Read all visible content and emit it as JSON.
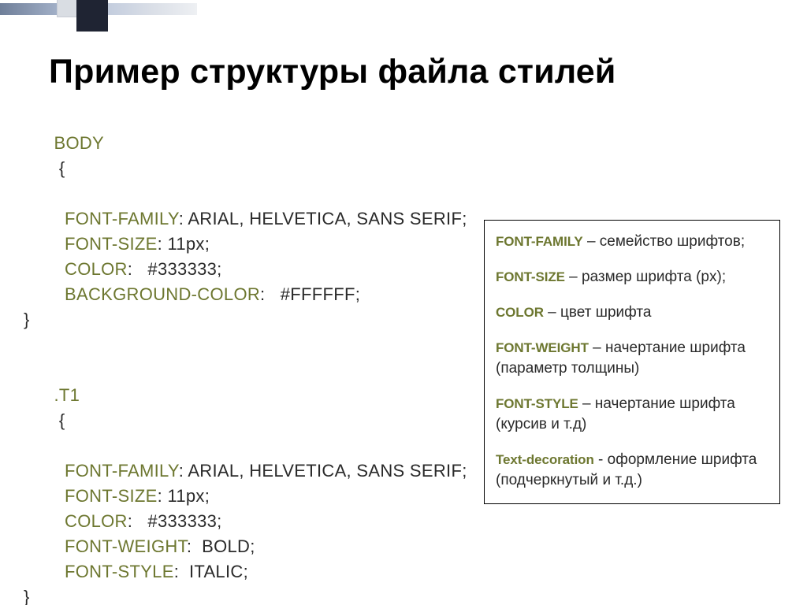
{
  "title": "Пример структуры файла стилей",
  "code": {
    "sel_body": "Body",
    "sel_t1": ".T1",
    "open": "{",
    "close": "}",
    "sep": ":",
    "end": ";",
    "body": {
      "font_family_k": "font-family",
      "font_family_v": "Arial, Helvetica, sans serif",
      "font_size_k": "font-size",
      "font_size_v": "11px",
      "color_k": "color",
      "color_v": "#333333",
      "bg_k": "background-color",
      "bg_v": "#FFFFFF"
    },
    "t1": {
      "font_family_k": "font-family",
      "font_family_v": "Arial, Helvetica, sans serif",
      "font_size_k": "font-size",
      "font_size_v": "11px",
      "color_k": "color",
      "color_v": "#333333",
      "font_weight_k": "font-weight",
      "font_weight_v": "bold",
      "font_style_k": "font-style",
      "font_style_v": "italic"
    }
  },
  "legend": {
    "font_family_t": "Font-family",
    "font_family_d": " – семейство шрифтов;",
    "font_size_t": "Font-size",
    "font_size_d": " – размер шрифта (px);",
    "color_t": "Color",
    "color_d": " – цвет шрифта",
    "font_weight_t": "Font-weight",
    "font_weight_d": " – начертание шрифта (параметр толщины)",
    "font_style_t": "Font-style",
    "font_style_d": " – начертание шрифта (курсив и т.д)",
    "text_decoration_t": "Text-decoration",
    "text_decoration_d": "  - оформление шрифта (подчеркнутый и т.д.)"
  }
}
